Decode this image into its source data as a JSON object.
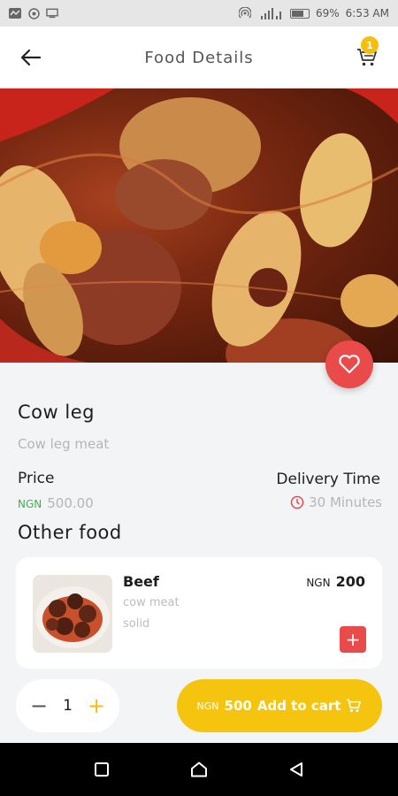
{
  "status_bar": {
    "battery": "69%",
    "time": "6:53 AM",
    "left_icons": [
      "activity-icon",
      "target-icon",
      "monitor-icon"
    ],
    "right_icons": [
      "hotspot-icon",
      "signal-icon",
      "battery-icon"
    ]
  },
  "header": {
    "title": "Food Details",
    "cart_count": "1"
  },
  "food": {
    "name": "Cow leg",
    "description": "Cow leg meat",
    "price_label": "Price",
    "currency": "NGN",
    "price": "500.00",
    "delivery_label": "Delivery Time",
    "delivery_time": "30 Minutes"
  },
  "other_food": {
    "title": "Other food",
    "items": [
      {
        "name": "Beef",
        "subtitle": "cow meat",
        "type": "solid",
        "currency": "NGN",
        "price": "200",
        "add_label": "+"
      }
    ]
  },
  "quantity": {
    "minus": "−",
    "value": "1",
    "plus": "+"
  },
  "add_to_cart": {
    "currency": "NGN",
    "amount": "500",
    "label": "Add to cart"
  },
  "colors": {
    "accent": "#f5c40f",
    "favorite": "#e94b4b",
    "currency_green": "#3bb34a"
  }
}
